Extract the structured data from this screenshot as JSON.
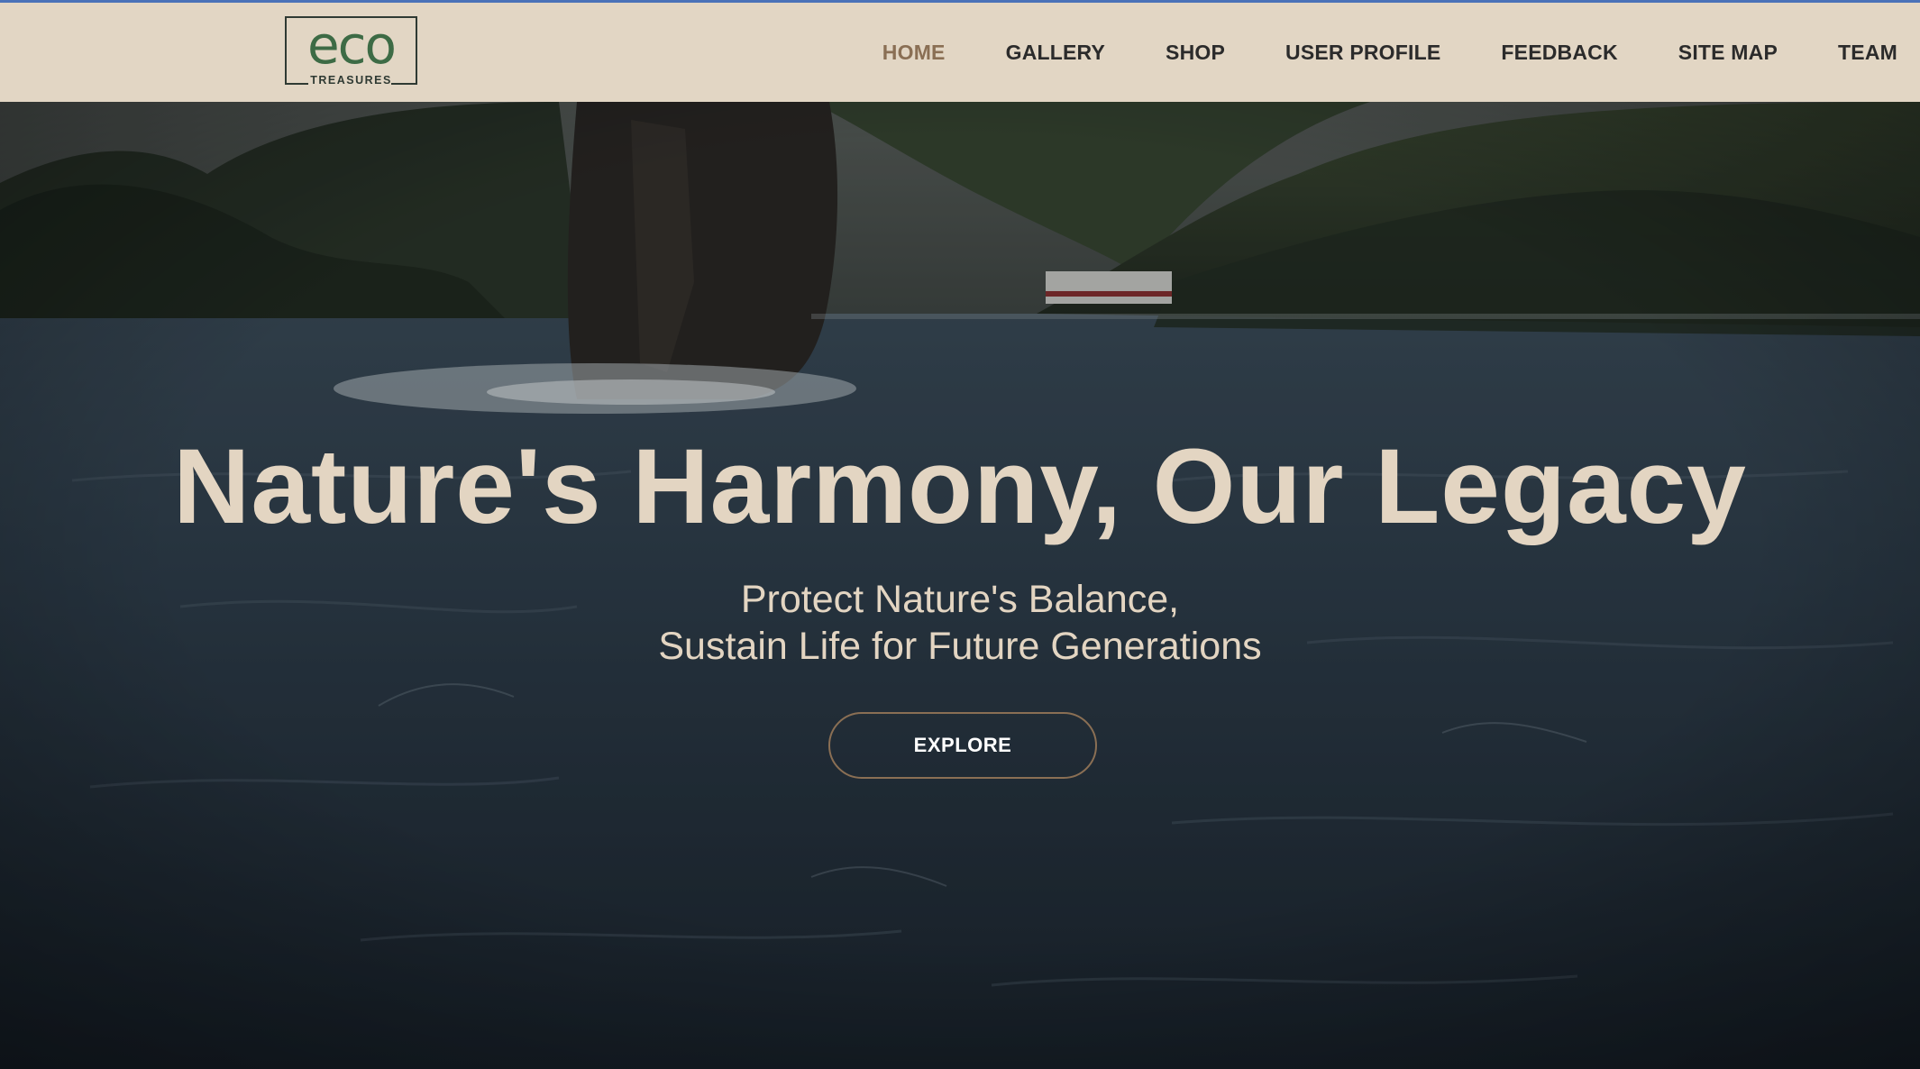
{
  "brand": {
    "logo_word": "eco",
    "logo_sub": "TREASURES"
  },
  "nav": {
    "items": [
      "HOME",
      "GALLERY",
      "SHOP",
      "USER PROFILE",
      "FEEDBACK",
      "SITE MAP",
      "TEAM"
    ],
    "active": "HOME"
  },
  "hero": {
    "headline": "Nature's Harmony, Our Legacy",
    "tagline_line1": "Protect Nature's Balance,",
    "tagline_line2": "Sustain Life for Future Generations",
    "cta_label": "EXPLORE"
  },
  "colors": {
    "nav_background": "#e2d6c4",
    "nav_text": "#2b2b2b",
    "nav_active": "#8a6f54",
    "logo_green": "#3d6b45",
    "hero_text": "#e3d5c2",
    "button_border": "#8a6f54"
  }
}
